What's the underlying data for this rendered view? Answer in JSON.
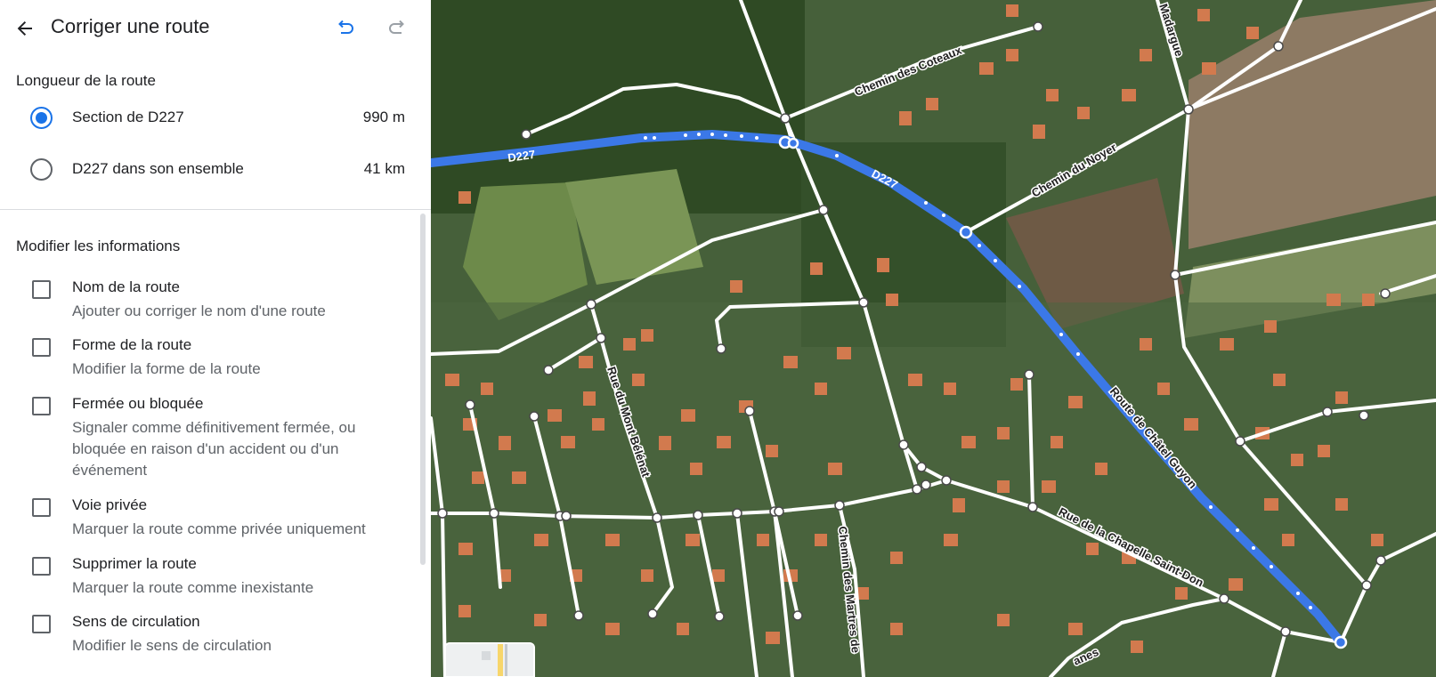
{
  "header": {
    "title": "Corriger une route",
    "back_icon": "arrow-back-icon",
    "undo_icon": "undo-icon",
    "redo_icon": "redo-icon",
    "accent_color": "#1a73e8"
  },
  "length_section": {
    "heading": "Longueur de la route",
    "options": [
      {
        "label": "Section de D227",
        "value": "990 m",
        "selected": true
      },
      {
        "label": "D227 dans son ensemble",
        "value": "41 km",
        "selected": false
      }
    ]
  },
  "modify_section": {
    "heading": "Modifier les informations",
    "items": [
      {
        "title": "Nom de la route",
        "desc": "Ajouter ou corriger le nom d'une route"
      },
      {
        "title": "Forme de la route",
        "desc": "Modifier la forme de la route"
      },
      {
        "title": "Fermée ou bloquée",
        "desc": "Signaler comme définitivement fermée, ou bloquée en raison d'un accident ou d'un événement"
      },
      {
        "title": "Voie privée",
        "desc": "Marquer la route comme privée uniquement"
      },
      {
        "title": "Supprimer la route",
        "desc": "Marquer la route comme inexistante"
      },
      {
        "title": "Sens de circulation",
        "desc": "Modifier le sens de circulation"
      }
    ]
  },
  "map": {
    "highlight_color": "#3b78e7",
    "labels": {
      "d227_a": "D227",
      "d227_b": "D227",
      "coteaux": "Chemin des Coteaux",
      "noyer": "Chemin du Noyer",
      "madargue": "Madargue",
      "chatel": "Route de Châtel Guyon",
      "belenat": "Rue du Mont Bélénat",
      "chapelle": "Rue de la Chapelle Saint-Don",
      "martres": "Chemin des Martres de",
      "anes": "anes"
    }
  }
}
